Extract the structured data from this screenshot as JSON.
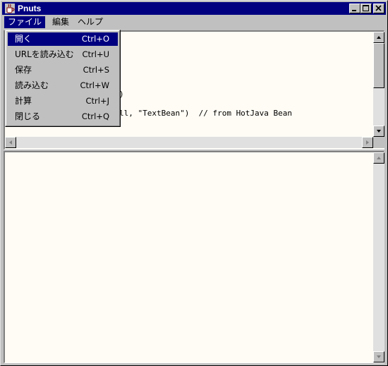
{
  "window": {
    "title": "Pnuts",
    "icon": "coffee-cup-icon"
  },
  "titlebar_buttons": [
    {
      "name": "minimize-button",
      "icon": "minimize-icon"
    },
    {
      "name": "maximize-button",
      "icon": "maximize-icon"
    },
    {
      "name": "close-button",
      "icon": "close-icon"
    }
  ],
  "menubar": {
    "items": [
      {
        "label": "ファイル",
        "active": true
      },
      {
        "label": "編集",
        "active": false
      },
      {
        "label": "ヘルプ",
        "active": false
      }
    ]
  },
  "file_menu": {
    "items": [
      {
        "label": "開く",
        "shortcut": "Ctrl+O",
        "selected": true
      },
      {
        "label": "URLを読み込む",
        "shortcut": "Ctrl+U",
        "selected": false
      },
      {
        "label": "保存",
        "shortcut": "Ctrl+S",
        "selected": false
      },
      {
        "label": "読み込む",
        "shortcut": "Ctrl+W",
        "selected": false
      },
      {
        "label": "計算",
        "shortcut": "Ctrl+J",
        "selected": false
      },
      {
        "label": "閉じる",
        "shortcut": "Ctrl+Q",
        "selected": false
      }
    ]
  },
  "editor": {
    "visible_lines": [
      ")",
      "ll, \"TextBean\")  // from HotJava Bean"
    ]
  },
  "colors": {
    "titlebar": "#000080",
    "selection": "#000080",
    "pane_background": "#fffcf5",
    "chrome": "#c0c0c0"
  }
}
